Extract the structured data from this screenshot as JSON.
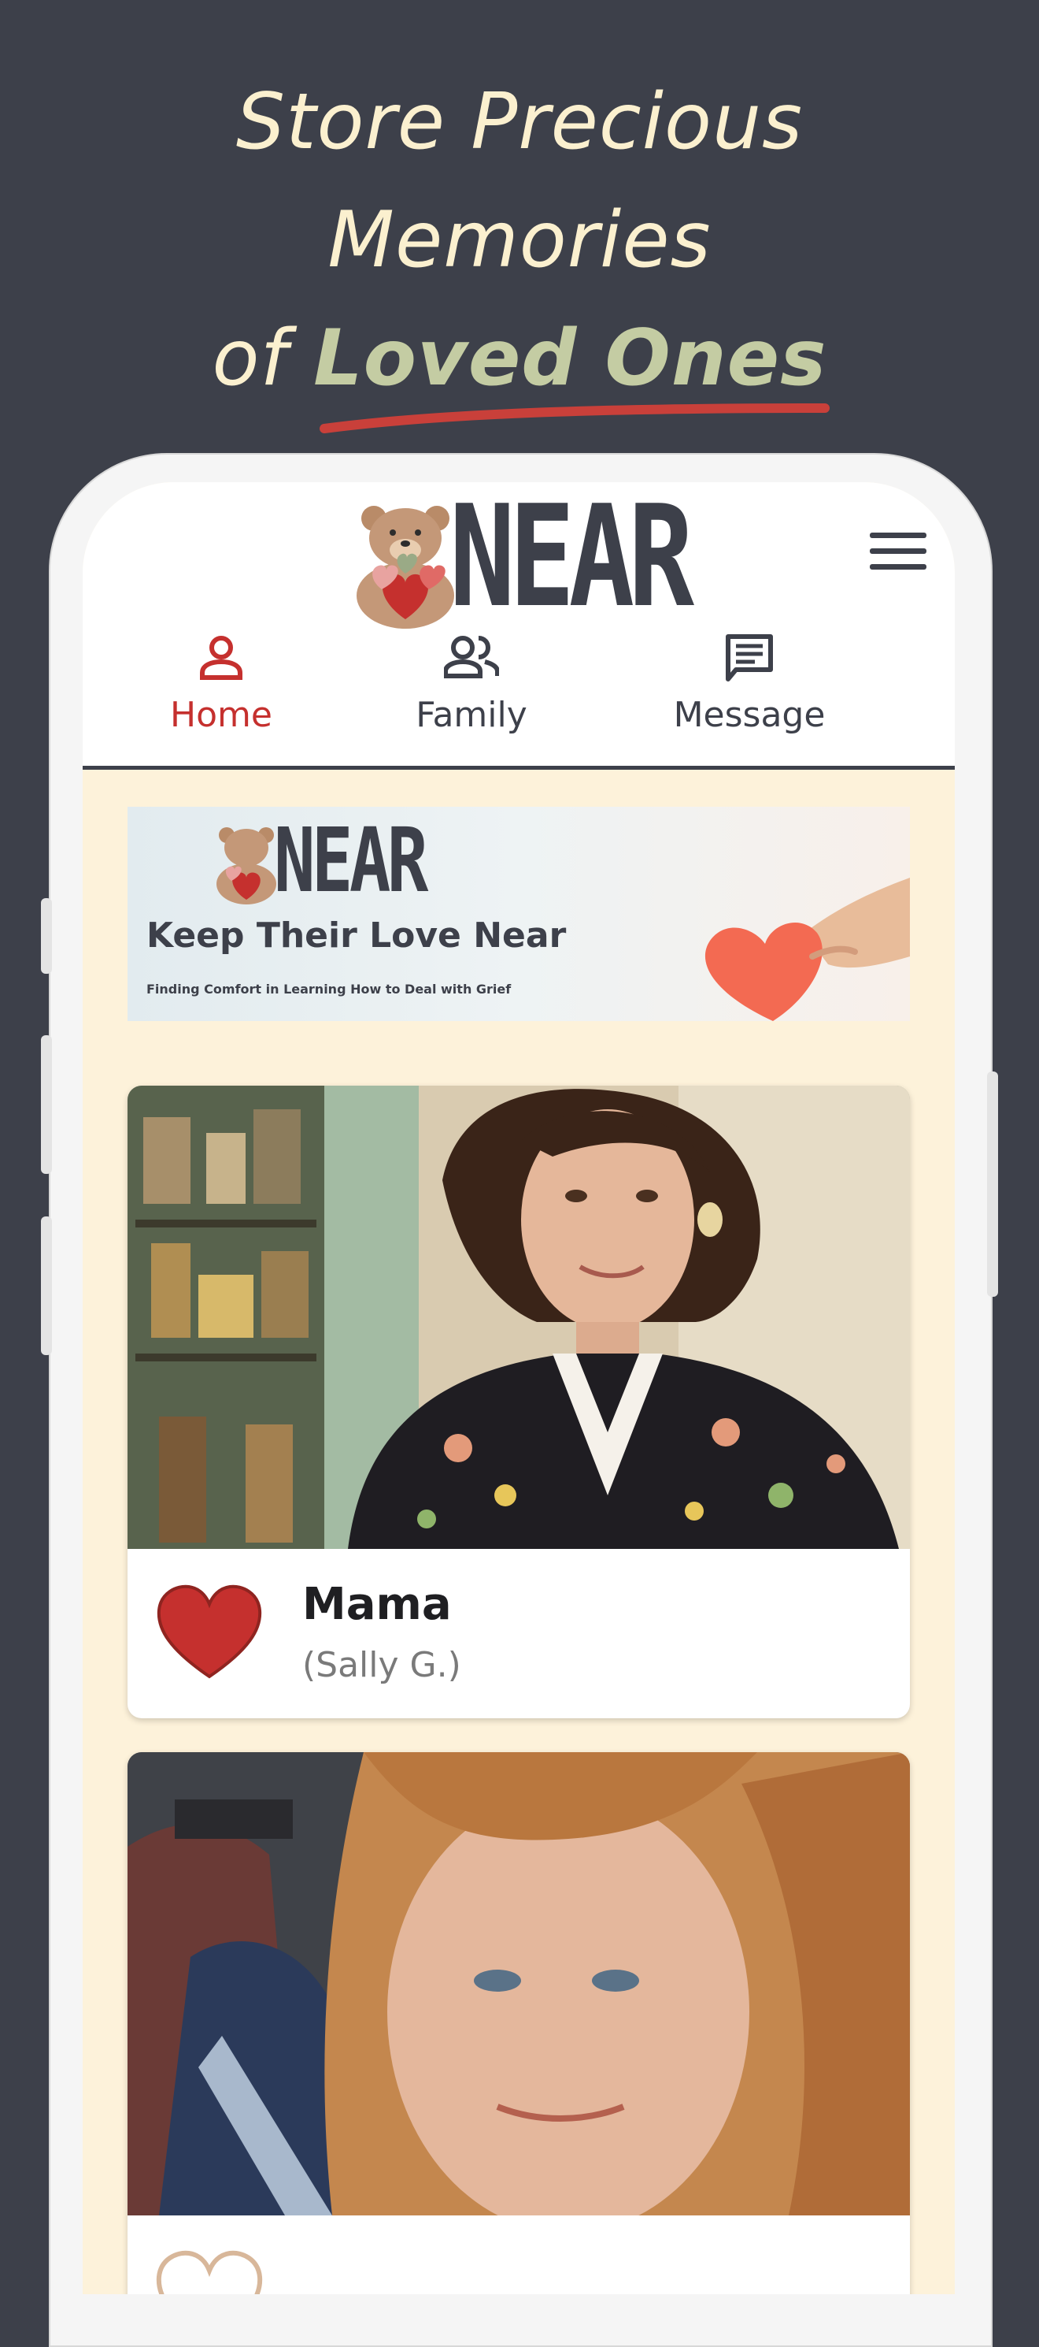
{
  "headline": {
    "line1": "Store Precious",
    "line2": "Memories",
    "line3_prefix": "of ",
    "line3_accent": "Loved Ones"
  },
  "app": {
    "logo_text": "NEAR",
    "tabs": [
      {
        "label": "Home",
        "icon": "person-icon",
        "active": true
      },
      {
        "label": "Family",
        "icon": "people-icon",
        "active": false
      },
      {
        "label": "Message",
        "icon": "message-icon",
        "active": false
      }
    ]
  },
  "banner": {
    "logo_text": "NEAR",
    "title": "Keep Their Love Near",
    "subtitle": "Finding Comfort in Learning How to Deal with Grief"
  },
  "cards": [
    {
      "name": "Mama",
      "relation": "(Sally G.)",
      "icon": "heart-icon"
    },
    {
      "name": "",
      "relation": "",
      "icon": "heart-icon"
    }
  ],
  "colors": {
    "background": "#3d404a",
    "accent_red": "#c5302e",
    "cream": "#fdf2da",
    "headline": "#fbf0cf",
    "headline_accent": "#c4cca3"
  }
}
